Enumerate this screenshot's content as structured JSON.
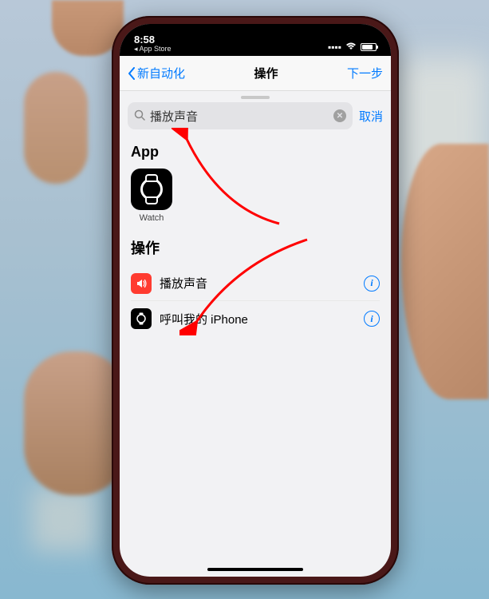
{
  "status": {
    "time": "8:58",
    "back_app": "◂ App Store"
  },
  "nav": {
    "back_label": "新自动化",
    "title": "操作",
    "next_label": "下一步"
  },
  "search": {
    "value": "播放声音",
    "cancel_label": "取消"
  },
  "sections": {
    "apps_header": "App",
    "actions_header": "操作"
  },
  "apps": [
    {
      "label": "Watch"
    }
  ],
  "actions": [
    {
      "label": "播放声音",
      "icon": "sound"
    },
    {
      "label": "呼叫我的 iPhone",
      "icon": "watch"
    }
  ]
}
